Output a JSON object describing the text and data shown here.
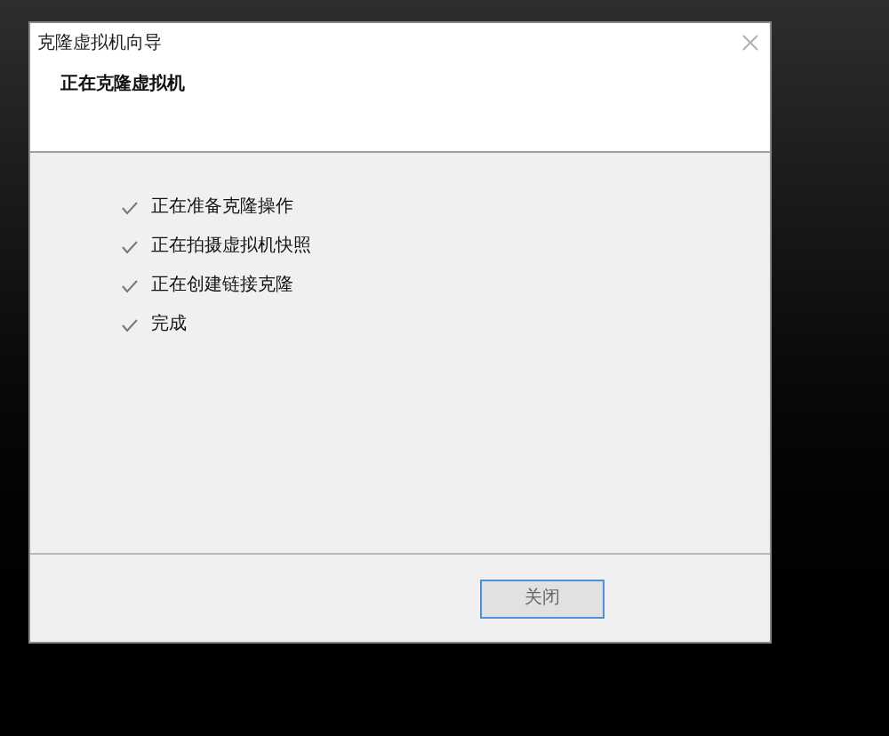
{
  "window": {
    "title": "克隆虚拟机向导"
  },
  "header": {
    "heading": "正在克隆虚拟机"
  },
  "steps": [
    {
      "label": "正在准备克隆操作",
      "done": true
    },
    {
      "label": "正在拍摄虚拟机快照",
      "done": true
    },
    {
      "label": "正在创建链接克隆",
      "done": true
    },
    {
      "label": "完成",
      "done": true
    }
  ],
  "buttons": [
    {
      "label": "关闭"
    }
  ]
}
